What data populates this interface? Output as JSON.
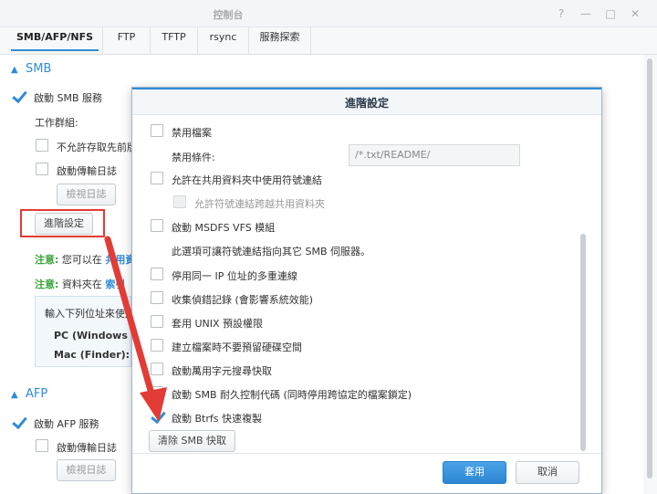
{
  "window": {
    "title": "控制台",
    "controls": [
      "help-icon",
      "minimize-icon",
      "maximize-icon",
      "close-icon"
    ],
    "help_glyph": "?",
    "min_glyph": "—",
    "max_glyph": "□",
    "close_glyph": "✕"
  },
  "tabs": [
    "SMB/AFP/NFS",
    "FTP",
    "TFTP",
    "rsync",
    "服務探索"
  ],
  "smb": {
    "header": "SMB",
    "enable_label": "啟動 SMB 服務",
    "workgroup_label": "工作群組:",
    "opt1": "不允許存取先前版",
    "opt2": "啟動傳輸日誌",
    "view_log": "檢視日誌",
    "advanced": "進階設定",
    "note1_key": "注意:",
    "note1_text": "您可以在",
    "note1_link": "共用資",
    "note2_key": "注意:",
    "note2_text": "資料夾在",
    "note2_link": "索引",
    "info_title": "輸入下列位址來使用",
    "info_pc": "PC (Windows 檔",
    "info_mac": "Mac (Finder):"
  },
  "afp": {
    "header": "AFP",
    "enable_label": "啟動 AFP 服務",
    "opt1": "啟動傳輸日誌",
    "view_log": "檢視日誌"
  },
  "dialog": {
    "title": "進階設定",
    "disable_file_label": "禁用檔案",
    "disable_ext_label": "禁用條件:",
    "disable_ext_value": "/*.txt/README/",
    "symlink_label": "允許在共用資料夾中使用符號連結",
    "symlink_cross_label": "允許符號連結跨越共用資料夾",
    "msdfs_label": "啟動 MSDFS VFS 模組",
    "msdfs_desc": "此選項可讓符號連結指向其它 SMB 伺服器。",
    "multi_conn_label": "停用同一 IP 位址的多重連線",
    "debug_log_label": "收集偵錯記錄 (會影響系統效能)",
    "unix_perm_label": "套用 UNIX 預設權限",
    "reserve_space_label": "建立檔案時不要預留硬碟空間",
    "wildcard_cache_label": "啟動萬用字元搜尋快取",
    "durable_handle_label": "啟動 SMB 耐久控制代碼 (同時停用跨協定的檔案鎖定)",
    "btrfs_copy_label": "啟動 Btrfs 快速複製",
    "clear_cache_button": "清除 SMB 快取",
    "apply_button": "套用",
    "cancel_button": "取消"
  },
  "colors": {
    "accent": "#2f8cd8",
    "annotation": "#e33b35",
    "note_green": "#3aa53a"
  }
}
